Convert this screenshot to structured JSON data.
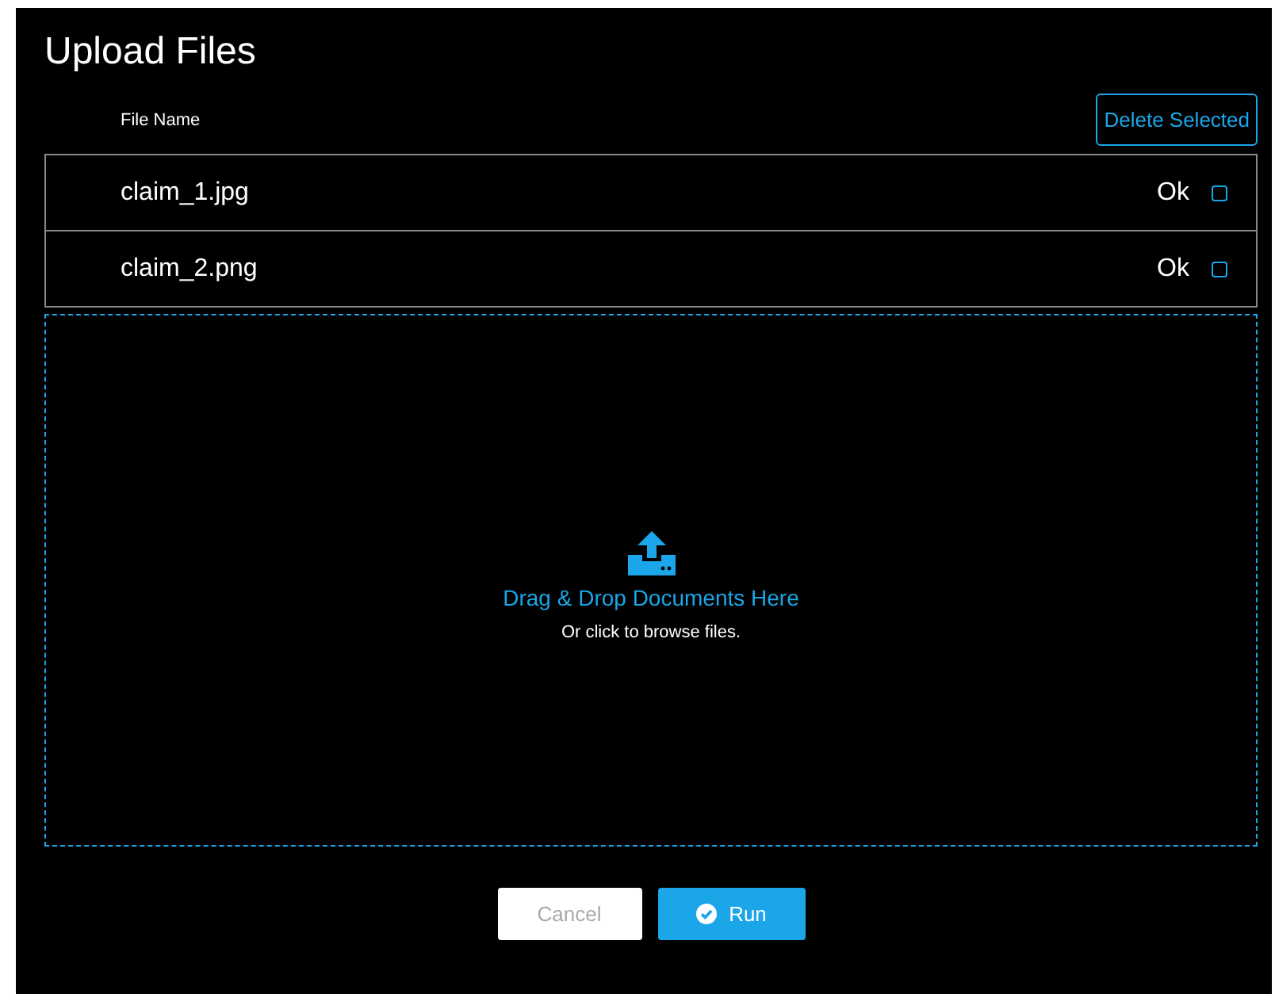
{
  "title": "Upload Files",
  "table": {
    "column_header": "File Name",
    "delete_button": "Delete Selected",
    "rows": [
      {
        "name": "claim_1.jpg",
        "status": "Ok",
        "checked": false
      },
      {
        "name": "claim_2.png",
        "status": "Ok",
        "checked": false
      }
    ]
  },
  "dropzone": {
    "heading": "Drag & Drop Documents Here",
    "hint": "Or click to browse files."
  },
  "buttons": [
    {
      "kind": "cancel",
      "label": "Cancel",
      "disabled": true
    },
    {
      "kind": "run",
      "label": "Run",
      "disabled": false
    }
  ]
}
